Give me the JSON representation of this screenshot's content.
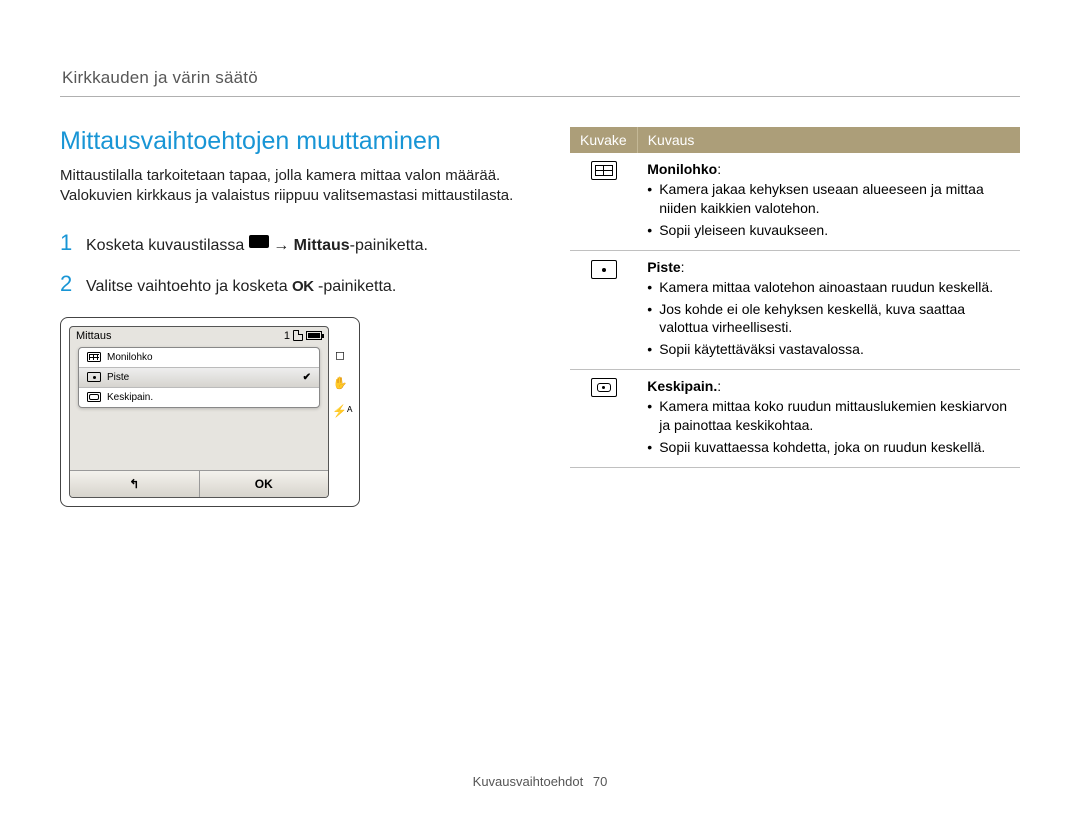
{
  "breadcrumb": "Kirkkauden ja värin säätö",
  "title": "Mittausvaihtoehtojen muuttaminen",
  "intro": "Mittaustilalla tarkoitetaan tapaa, jolla kamera mittaa valon määrää. Valokuvien kirkkaus ja valaistus riippuu valitsemastasi mittaustilasta.",
  "steps": [
    {
      "num": "1",
      "pre": "Kosketa kuvaustilassa ",
      "post_arrow": "→",
      "bold": "Mittaus",
      "suffix": "-painiketta."
    },
    {
      "num": "2",
      "pre": "Valitse vaihtoehto ja kosketa ",
      "ok": "OK",
      "suffix": "-painiketta."
    }
  ],
  "screen": {
    "title": "Mittaus",
    "counter": "1",
    "items": [
      {
        "label": "Monilohko",
        "selected": false
      },
      {
        "label": "Piste",
        "selected": true
      },
      {
        "label": "Keskipain.",
        "selected": false
      }
    ],
    "back": "↰",
    "ok": "OK",
    "side": [
      "◻",
      "✋",
      "⚡ᴬ"
    ]
  },
  "table": {
    "headers": {
      "icon": "Kuvake",
      "desc": "Kuvaus"
    },
    "rows": [
      {
        "name": "Monilohko",
        "colon": ":",
        "bullets": [
          "Kamera jakaa kehyksen useaan alueeseen ja mittaa niiden kaikkien valotehon.",
          "Sopii yleiseen kuvaukseen."
        ]
      },
      {
        "name": "Piste",
        "colon": ":",
        "bullets": [
          "Kamera mittaa valotehon ainoastaan ruudun keskellä.",
          "Jos kohde ei ole kehyksen keskellä, kuva saattaa valottua virheellisesti.",
          "Sopii käytettäväksi vastavalossa."
        ]
      },
      {
        "name": "Keskipain.",
        "colon": ":",
        "bullets": [
          "Kamera mittaa koko ruudun mittauslukemien keskiarvon ja painottaa keskikohtaa.",
          "Sopii kuvattaessa kohdetta, joka on ruudun keskellä."
        ]
      }
    ]
  },
  "footer": {
    "section": "Kuvausvaihtoehdot",
    "page": "70"
  }
}
